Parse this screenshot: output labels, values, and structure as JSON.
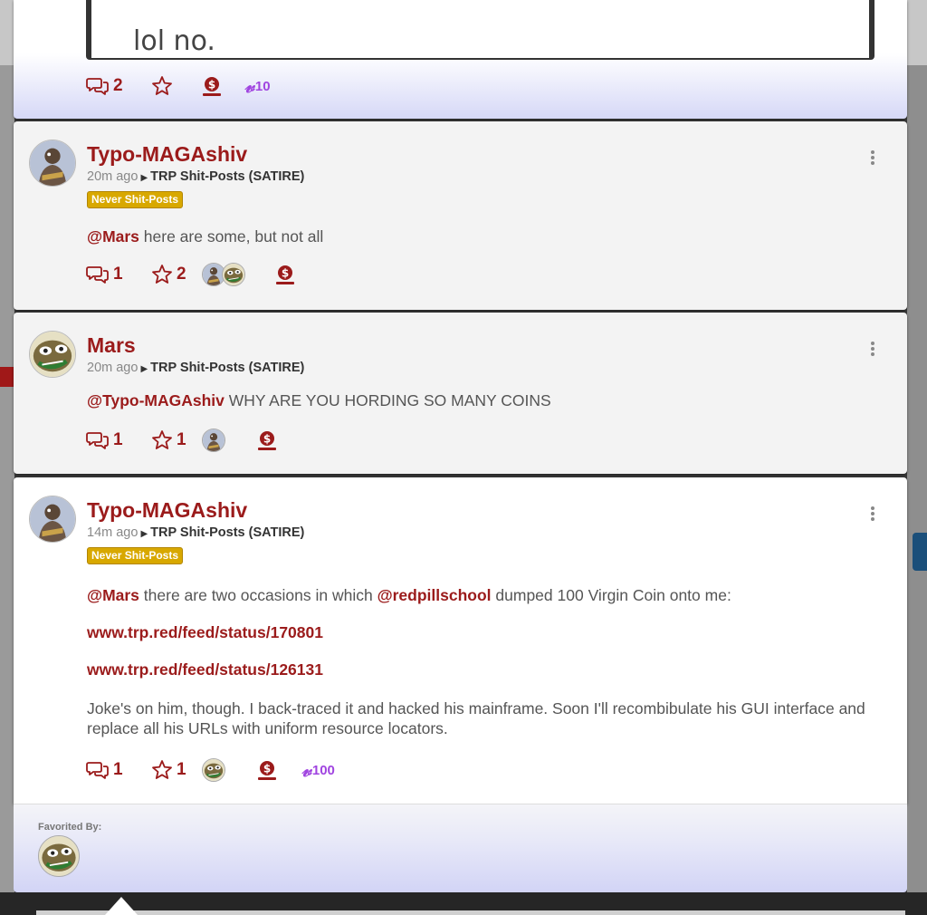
{
  "top_post": {
    "quote": "lol no.",
    "actions": {
      "comments": "2",
      "vcoin": "10"
    }
  },
  "icons": {
    "comment": "comment-bubbles-icon",
    "star": "star-icon",
    "coin": "coin-hand-icon",
    "vcoin": "virgin-coin-icon",
    "more": "kebab-menu-icon",
    "caret": "caret-right-icon"
  },
  "vcoin_symbol": "𝓋",
  "comments": [
    {
      "author": "Typo-MAGAshiv",
      "time": "20m ago",
      "community": "TRP Shit-Posts (SATIRE)",
      "flair": "Never Shit-Posts",
      "mention": "@Mars",
      "text": " here are some, but not all",
      "actions": {
        "comments": "1",
        "stars": "2"
      }
    },
    {
      "author": "Mars",
      "time": "20m ago",
      "community": "TRP Shit-Posts (SATIRE)",
      "mention": "@Typo-MAGAshiv",
      "text": " WHY ARE YOU HORDING SO MANY COINS",
      "actions": {
        "comments": "1",
        "stars": "1"
      }
    },
    {
      "author": "Typo-MAGAshiv",
      "time": "14m ago",
      "community": "TRP Shit-Posts (SATIRE)",
      "flair": "Never Shit-Posts",
      "mention": "@Mars",
      "text_a": " there are two occasions in which ",
      "mention2": "@redpillschool",
      "text_b": " dumped 100 Virgin Coin onto me:",
      "link1": "www.trp.red/feed/status/170801",
      "link2": "www.trp.red/feed/status/126131",
      "paragraph": "Joke's on him, though. I back-traced it and hacked his mainframe. Soon I'll recombibulate his GUI interface and replace all his URLs with uniform resource locators.",
      "actions": {
        "comments": "1",
        "stars": "1",
        "vcoin": "100"
      }
    }
  ],
  "favorited": {
    "label": "Favorited By:"
  }
}
